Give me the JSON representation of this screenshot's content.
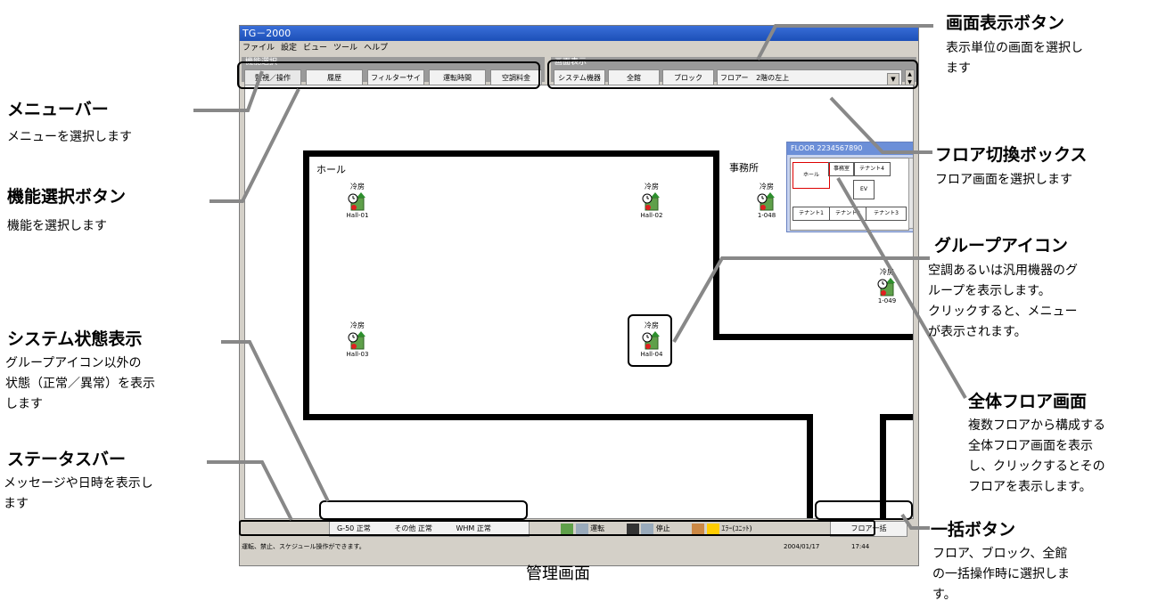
{
  "window": {
    "title": "TG－2000"
  },
  "menubar": [
    "ファイル",
    "設定",
    "ビュー",
    "ツール",
    "ヘルプ"
  ],
  "function_panel": {
    "title": "機能選択",
    "buttons": [
      "監視／操作",
      "履歴",
      "フィルターサイン",
      "運転時間",
      "空調料金"
    ]
  },
  "screen_panel": {
    "title": "画面表示",
    "buttons": [
      "システム機器",
      "全館",
      "ブロック"
    ],
    "floor_label": "フロアー",
    "floor_value": "2階の左上"
  },
  "floor_overview": {
    "title": "FLOOR 2234567890",
    "rooms": [
      "ホール",
      "事務室",
      "テナント4",
      "EV",
      "テナント1",
      "テナント2",
      "テナント3"
    ]
  },
  "rooms": {
    "hall": "ホール",
    "office": "事務所"
  },
  "groups": [
    {
      "mode": "冷房",
      "name": "Hall-01"
    },
    {
      "mode": "冷房",
      "name": "Hall-02"
    },
    {
      "mode": "冷房",
      "name": "1-048"
    },
    {
      "mode": "冷房",
      "name": "1-049"
    },
    {
      "mode": "冷房",
      "name": "Hall-03"
    },
    {
      "mode": "冷房",
      "name": "Hall-04"
    }
  ],
  "system_status": {
    "g50": "G-50 正常",
    "other": "その他 正常",
    "whm": "WHM 正常"
  },
  "legend": {
    "run": "運転",
    "stop": "停止",
    "error": "ｴﾗｰ(ﾕﾆｯﾄ)"
  },
  "bulk_button": "フロア一括",
  "statusbar": {
    "message": "運転、禁止、スケジュール操作ができます。",
    "date": "2004/01/17",
    "time": "17:44"
  },
  "caption": "管理画面",
  "annotations": {
    "menu_bar": {
      "title": "メニューバー",
      "desc": [
        "メニューを選択します"
      ]
    },
    "function_btn": {
      "title": "機能選択ボタン",
      "desc": [
        "機能を選択します"
      ]
    },
    "system_status": {
      "title": "システム状態表示",
      "desc": [
        "グループアイコン以外の",
        "状態（正常／異常）を表示",
        "します"
      ]
    },
    "status_bar": {
      "title": "ステータスバー",
      "desc": [
        "メッセージや日時を表示し",
        "ます"
      ]
    },
    "screen_btn": {
      "title": "画面表示ボタン",
      "desc": [
        "表示単位の画面を選択し",
        "ます"
      ]
    },
    "floor_box": {
      "title": "フロア切換ボックス",
      "desc": [
        "フロア画面を選択します"
      ]
    },
    "group_icon": {
      "title": "グループアイコン",
      "desc": [
        "空調あるいは汎用機器のグ",
        "ループを表示します。",
        "クリックすると、メニュー",
        "が表示されます。"
      ]
    },
    "all_floor": {
      "title": "全体フロア画面",
      "desc": [
        "複数フロアから構成する",
        "全体フロア画面を表示",
        "し、クリックするとその",
        "フロアを表示します。"
      ]
    },
    "bulk_btn": {
      "title": "一括ボタン",
      "desc": [
        "フロア、ブロック、全館",
        "の一括操作時に選択しま",
        "す。"
      ]
    }
  }
}
